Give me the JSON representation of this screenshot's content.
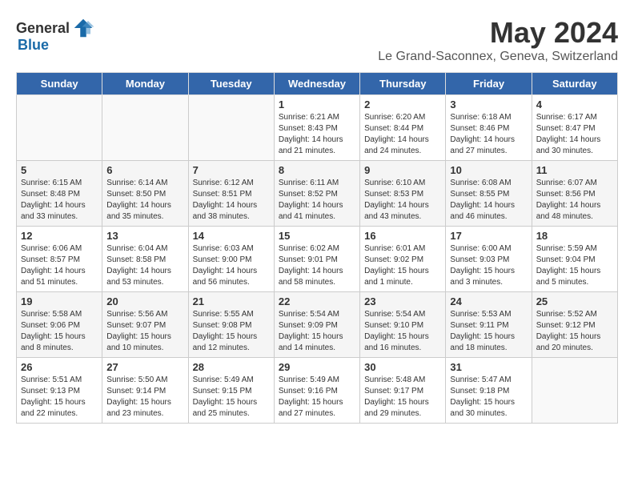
{
  "header": {
    "logo_general": "General",
    "logo_blue": "Blue",
    "month_year": "May 2024",
    "location": "Le Grand-Saconnex, Geneva, Switzerland"
  },
  "weekdays": [
    "Sunday",
    "Monday",
    "Tuesday",
    "Wednesday",
    "Thursday",
    "Friday",
    "Saturday"
  ],
  "weeks": [
    [
      {
        "day": null,
        "text": ""
      },
      {
        "day": null,
        "text": ""
      },
      {
        "day": null,
        "text": ""
      },
      {
        "day": "1",
        "text": "Sunrise: 6:21 AM\nSunset: 8:43 PM\nDaylight: 14 hours\nand 21 minutes."
      },
      {
        "day": "2",
        "text": "Sunrise: 6:20 AM\nSunset: 8:44 PM\nDaylight: 14 hours\nand 24 minutes."
      },
      {
        "day": "3",
        "text": "Sunrise: 6:18 AM\nSunset: 8:46 PM\nDaylight: 14 hours\nand 27 minutes."
      },
      {
        "day": "4",
        "text": "Sunrise: 6:17 AM\nSunset: 8:47 PM\nDaylight: 14 hours\nand 30 minutes."
      }
    ],
    [
      {
        "day": "5",
        "text": "Sunrise: 6:15 AM\nSunset: 8:48 PM\nDaylight: 14 hours\nand 33 minutes."
      },
      {
        "day": "6",
        "text": "Sunrise: 6:14 AM\nSunset: 8:50 PM\nDaylight: 14 hours\nand 35 minutes."
      },
      {
        "day": "7",
        "text": "Sunrise: 6:12 AM\nSunset: 8:51 PM\nDaylight: 14 hours\nand 38 minutes."
      },
      {
        "day": "8",
        "text": "Sunrise: 6:11 AM\nSunset: 8:52 PM\nDaylight: 14 hours\nand 41 minutes."
      },
      {
        "day": "9",
        "text": "Sunrise: 6:10 AM\nSunset: 8:53 PM\nDaylight: 14 hours\nand 43 minutes."
      },
      {
        "day": "10",
        "text": "Sunrise: 6:08 AM\nSunset: 8:55 PM\nDaylight: 14 hours\nand 46 minutes."
      },
      {
        "day": "11",
        "text": "Sunrise: 6:07 AM\nSunset: 8:56 PM\nDaylight: 14 hours\nand 48 minutes."
      }
    ],
    [
      {
        "day": "12",
        "text": "Sunrise: 6:06 AM\nSunset: 8:57 PM\nDaylight: 14 hours\nand 51 minutes."
      },
      {
        "day": "13",
        "text": "Sunrise: 6:04 AM\nSunset: 8:58 PM\nDaylight: 14 hours\nand 53 minutes."
      },
      {
        "day": "14",
        "text": "Sunrise: 6:03 AM\nSunset: 9:00 PM\nDaylight: 14 hours\nand 56 minutes."
      },
      {
        "day": "15",
        "text": "Sunrise: 6:02 AM\nSunset: 9:01 PM\nDaylight: 14 hours\nand 58 minutes."
      },
      {
        "day": "16",
        "text": "Sunrise: 6:01 AM\nSunset: 9:02 PM\nDaylight: 15 hours\nand 1 minute."
      },
      {
        "day": "17",
        "text": "Sunrise: 6:00 AM\nSunset: 9:03 PM\nDaylight: 15 hours\nand 3 minutes."
      },
      {
        "day": "18",
        "text": "Sunrise: 5:59 AM\nSunset: 9:04 PM\nDaylight: 15 hours\nand 5 minutes."
      }
    ],
    [
      {
        "day": "19",
        "text": "Sunrise: 5:58 AM\nSunset: 9:06 PM\nDaylight: 15 hours\nand 8 minutes."
      },
      {
        "day": "20",
        "text": "Sunrise: 5:56 AM\nSunset: 9:07 PM\nDaylight: 15 hours\nand 10 minutes."
      },
      {
        "day": "21",
        "text": "Sunrise: 5:55 AM\nSunset: 9:08 PM\nDaylight: 15 hours\nand 12 minutes."
      },
      {
        "day": "22",
        "text": "Sunrise: 5:54 AM\nSunset: 9:09 PM\nDaylight: 15 hours\nand 14 minutes."
      },
      {
        "day": "23",
        "text": "Sunrise: 5:54 AM\nSunset: 9:10 PM\nDaylight: 15 hours\nand 16 minutes."
      },
      {
        "day": "24",
        "text": "Sunrise: 5:53 AM\nSunset: 9:11 PM\nDaylight: 15 hours\nand 18 minutes."
      },
      {
        "day": "25",
        "text": "Sunrise: 5:52 AM\nSunset: 9:12 PM\nDaylight: 15 hours\nand 20 minutes."
      }
    ],
    [
      {
        "day": "26",
        "text": "Sunrise: 5:51 AM\nSunset: 9:13 PM\nDaylight: 15 hours\nand 22 minutes."
      },
      {
        "day": "27",
        "text": "Sunrise: 5:50 AM\nSunset: 9:14 PM\nDaylight: 15 hours\nand 23 minutes."
      },
      {
        "day": "28",
        "text": "Sunrise: 5:49 AM\nSunset: 9:15 PM\nDaylight: 15 hours\nand 25 minutes."
      },
      {
        "day": "29",
        "text": "Sunrise: 5:49 AM\nSunset: 9:16 PM\nDaylight: 15 hours\nand 27 minutes."
      },
      {
        "day": "30",
        "text": "Sunrise: 5:48 AM\nSunset: 9:17 PM\nDaylight: 15 hours\nand 29 minutes."
      },
      {
        "day": "31",
        "text": "Sunrise: 5:47 AM\nSunset: 9:18 PM\nDaylight: 15 hours\nand 30 minutes."
      },
      {
        "day": null,
        "text": ""
      }
    ]
  ]
}
